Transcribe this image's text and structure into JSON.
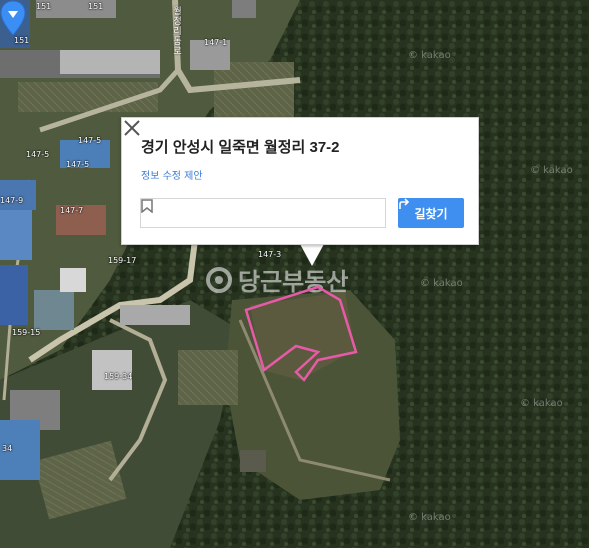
{
  "popup": {
    "address": "경기 안성시 일죽면 월정리 37-2",
    "suggest_edit": "정보 수정 제안",
    "directions_label": "길찾기"
  },
  "watermark": {
    "text": "당근부동산"
  },
  "map_credit": "© kakao",
  "road_name": "월정리동로",
  "parcels": [
    "151",
    "151",
    "151",
    "147-1",
    "147-5",
    "147-5",
    "147-5",
    "147-9",
    "147-7",
    "147-3",
    "159-17",
    "159-15",
    "159-34",
    "34"
  ],
  "colors": {
    "parcel_outline": "#e85aa8",
    "pin": "#3b8ef3",
    "button": "#3f8ff0",
    "link": "#3a7bd5"
  }
}
